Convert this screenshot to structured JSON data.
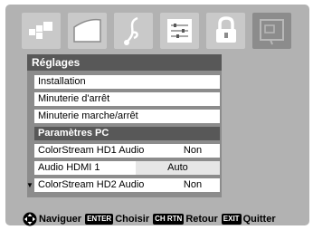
{
  "icons": [
    {
      "name": "picture-icon"
    },
    {
      "name": "sound-icon"
    },
    {
      "name": "music-icon"
    },
    {
      "name": "settings-icon"
    },
    {
      "name": "lock-icon"
    },
    {
      "name": "setup-icon"
    }
  ],
  "menu": {
    "title": "Réglages",
    "items": [
      {
        "label": "Installation"
      },
      {
        "label": "Minuterie d'arrêt"
      },
      {
        "label": "Minuterie marche/arrêt"
      },
      {
        "label": "Paramètres PC"
      },
      {
        "label": "ColorStream HD1 Audio",
        "value": "Non"
      },
      {
        "label": "Audio HDMI 1",
        "value": "Auto"
      },
      {
        "label": "ColorStream HD2 Audio",
        "value": "Non"
      }
    ]
  },
  "footer": {
    "nav_label": "Naviguer",
    "enter_key": "ENTER",
    "enter_label": "Choisir",
    "return_key": "CH RTN",
    "return_label": "Retour",
    "exit_key": "EXIT",
    "exit_label": "Quitter"
  }
}
